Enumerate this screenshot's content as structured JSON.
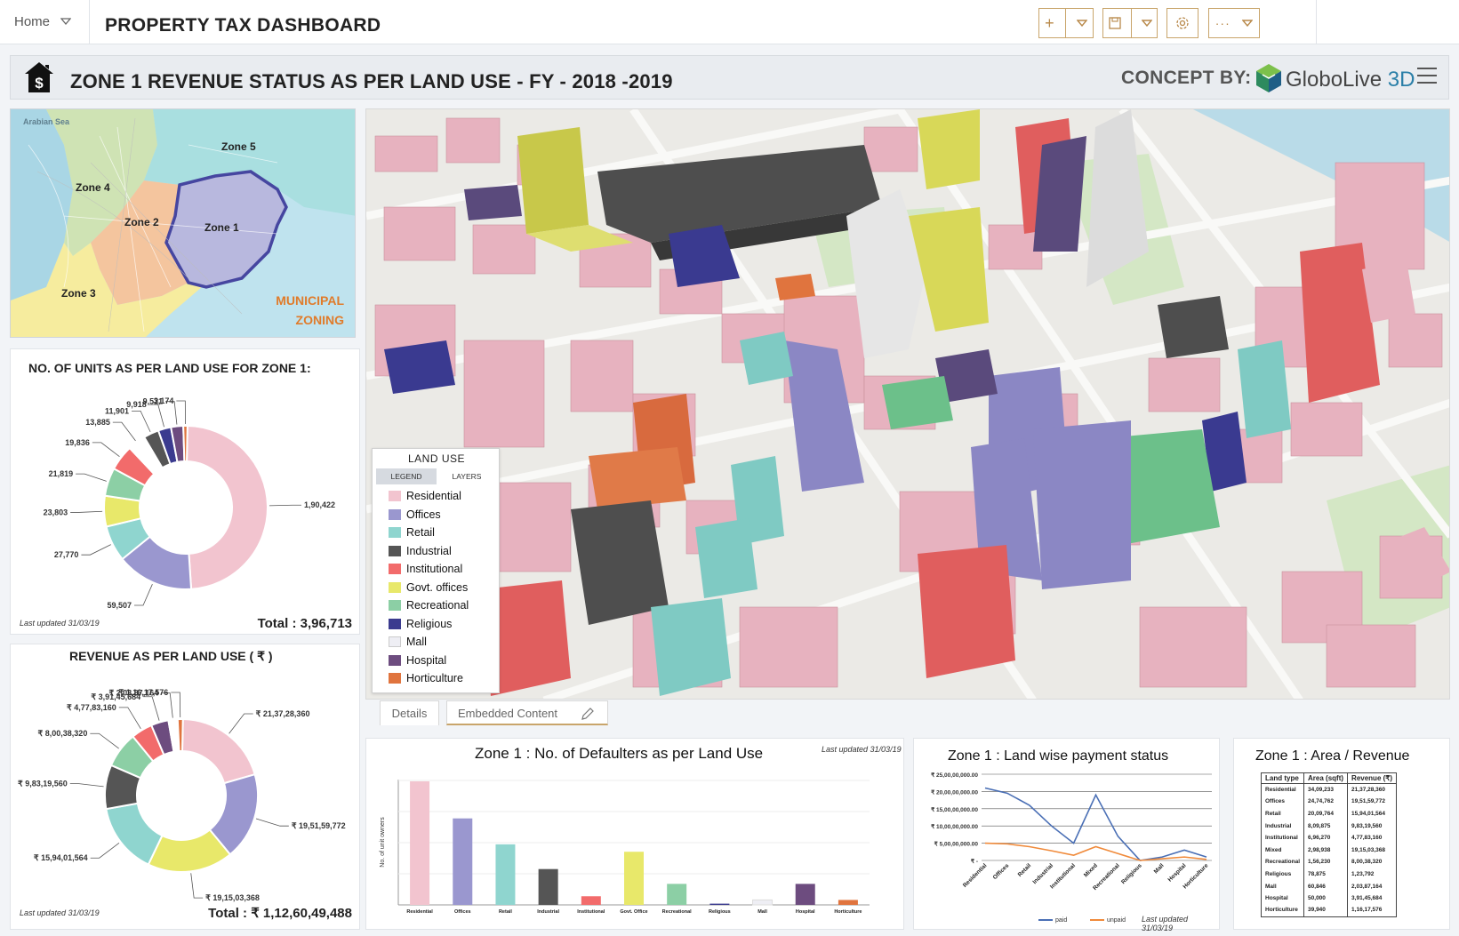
{
  "topbar": {
    "home_label": "Home",
    "dashboard_title": "PROPERTY TAX DASHBOARD",
    "buttons": [
      {
        "icon": "plus-icon",
        "has_dropdown": true
      },
      {
        "icon": "save-icon",
        "has_dropdown": true
      },
      {
        "icon": "gear-icon",
        "has_dropdown": false
      },
      {
        "icon": "more-icon",
        "has_dropdown": true
      }
    ]
  },
  "header": {
    "title": "ZONE 1 REVENUE STATUS AS PER LAND USE - FY - 2018 -2019",
    "concept_by": "CONCEPT BY:",
    "logo_text": "GloboLive",
    "logo_suffix": "3D"
  },
  "zone_map": {
    "sea_label": "Arabian Sea",
    "zones": [
      "Zone 5",
      "Zone 4",
      "Zone 2",
      "Zone 1",
      "Zone 3"
    ],
    "caption_line1": "MUNICIPAL",
    "caption_line2": "ZONING"
  },
  "units_panel": {
    "title": "NO. OF UNITS AS PER LAND USE FOR ZONE 1:",
    "last_updated": "Last updated 31/03/19",
    "total": "Total : 3,96,713"
  },
  "revenue_panel": {
    "title": "REVENUE AS PER LAND USE ( ₹ )",
    "last_updated": "Last updated 31/03/19",
    "total": "Total : ₹ 1,12,60,49,488"
  },
  "legend": {
    "title": "LAND USE",
    "tab_legend": "LEGEND",
    "tab_layers": "LAYERS",
    "items": [
      {
        "label": "Residential",
        "color": "#f2c4cf"
      },
      {
        "label": "Offices",
        "color": "#9a97cf"
      },
      {
        "label": "Retail",
        "color": "#8fd5cf"
      },
      {
        "label": "Industrial",
        "color": "#555555"
      },
      {
        "label": "Institutional",
        "color": "#f26b6b"
      },
      {
        "label": "Govt. offices",
        "color": "#e8e86a"
      },
      {
        "label": "Recreational",
        "color": "#8ccfa5"
      },
      {
        "label": "Religious",
        "color": "#3b3b8f"
      },
      {
        "label": "Mall",
        "color": "#eeeef4"
      },
      {
        "label": "Hospital",
        "color": "#6d4c7f"
      },
      {
        "label": "Horticulture",
        "color": "#e0743e"
      }
    ]
  },
  "tabs": {
    "details": "Details",
    "embedded": "Embedded Content"
  },
  "defaulters_panel": {
    "title": "Zone 1 : No. of Defaulters as per Land Use",
    "last_updated": "Last updated 31/03/19"
  },
  "payment_panel": {
    "title": "Zone 1 : Land wise payment status",
    "last_updated": "Last updated 31/03/19"
  },
  "area_panel": {
    "title": "Zone 1 : Area / Revenue",
    "columns": [
      "Land type",
      "Area (sqft)",
      "Revenue (₹)"
    ],
    "rows": [
      [
        "Residential",
        "34,09,233",
        "21,37,28,360"
      ],
      [
        "Offices",
        "24,74,762",
        "19,51,59,772"
      ],
      [
        "Retail",
        "20,09,764",
        "15,94,01,564"
      ],
      [
        "Industrial",
        "8,09,875",
        "9,83,19,560"
      ],
      [
        "Institutional",
        "6,96,270",
        "4,77,83,160"
      ],
      [
        "Mixed",
        "2,98,938",
        "19,15,03,368"
      ],
      [
        "Recreational",
        "1,56,230",
        "8,00,38,320"
      ],
      [
        "Religious",
        "78,875",
        "1,23,792"
      ],
      [
        "Mall",
        "60,846",
        "2,03,87,164"
      ],
      [
        "Hospital",
        "50,000",
        "3,91,45,684"
      ],
      [
        "Horticulture",
        "39,940",
        "1,16,17,576"
      ]
    ]
  },
  "chart_data": [
    {
      "type": "pie",
      "title": "NO. OF UNITS AS PER LAND USE FOR ZONE 1:",
      "categories": [
        "Residential",
        "Offices",
        "Retail",
        "Industrial",
        "Institutional",
        "Govt. offices",
        "Recreational",
        "Religious",
        "Mall",
        "Hospital",
        "Horticulture"
      ],
      "values": [
        190422,
        59507,
        27770,
        23803,
        21819,
        19836,
        13885,
        11901,
        9918,
        9521,
        3174
      ],
      "labels": [
        "1,90,422",
        "59,507",
        "27,770",
        "23,803",
        "21,819",
        "19,836",
        "13,885",
        "11,901",
        "9,918",
        "9,521",
        "3,174"
      ],
      "colors": [
        "#f2c4cf",
        "#9a97cf",
        "#8fd5cf",
        "#e8e86a",
        "#8ccfa5",
        "#f26b6b",
        "#ffffff",
        "#555555",
        "#3b3b8f",
        "#6d4c7f",
        "#e0743e"
      ],
      "donut": true
    },
    {
      "type": "pie",
      "title": "REVENUE AS PER LAND USE ( ₹ )",
      "categories": [
        "Residential",
        "Offices",
        "Govt. offices",
        "Retail",
        "Industrial",
        "Recreational",
        "Institutional",
        "Hospital",
        "Mall",
        "Religious",
        "Horticulture"
      ],
      "values": [
        213728360,
        195159772,
        191503368,
        159401564,
        98319560,
        80038320,
        47783160,
        39145684,
        20387164,
        123792,
        11617576
      ],
      "labels": [
        "₹ 21,37,28,360",
        "₹ 19,51,59,772",
        "₹ 19,15,03,368",
        "₹ 15,94,01,564",
        "₹ 9,83,19,560",
        "₹ 8,00,38,320",
        "₹ 4,77,83,160",
        "₹ 3,91,45,684",
        "₹ 2,03,87,164",
        "",
        "₹ 1,16,17,576"
      ],
      "colors": [
        "#f2c4cf",
        "#9a97cf",
        "#e8e86a",
        "#8fd5cf",
        "#555555",
        "#8ccfa5",
        "#f26b6b",
        "#6d4c7f",
        "#ffffff",
        "#3b3b8f",
        "#e0743e"
      ],
      "donut": true
    },
    {
      "type": "bar",
      "title": "Zone 1 : No. of Defaulters as per Land Use",
      "ylabel": "No. of unit owners",
      "categories": [
        "Residential",
        "Offices",
        "Retail",
        "Industrial",
        "Institutional",
        "Govt. Office",
        "Recreational",
        "Religious",
        "Mall",
        "Hospital",
        "Horticulture"
      ],
      "values": [
        100,
        70,
        49,
        29,
        7,
        43,
        17,
        1,
        4,
        17,
        4
      ],
      "colors": [
        "#f2c4cf",
        "#9a97cf",
        "#8fd5cf",
        "#555555",
        "#f26b6b",
        "#e8e86a",
        "#8ccfa5",
        "#3b3b8f",
        "#eeeef4",
        "#6d4c7f",
        "#e0743e"
      ]
    },
    {
      "type": "line",
      "title": "Zone 1 : Land wise payment status",
      "categories": [
        "Residential",
        "Offices",
        "Retail",
        "Industrial",
        "Institutional",
        "Mixed",
        "Recreational",
        "Religious",
        "Mall",
        "Hospital",
        "Horticulture"
      ],
      "yticks": [
        "₹ 25,00,00,000.00",
        "₹ 20,00,00,000.00",
        "₹ 15,00,00,000.00",
        "₹ 10,00,00,000.00",
        "₹ 5,00,00,000.00",
        "₹ -"
      ],
      "ylim": [
        0,
        250000000
      ],
      "series": [
        {
          "name": "paid",
          "color": "#4a6fb5",
          "values": [
            210000000,
            195000000,
            160000000,
            100000000,
            50000000,
            190000000,
            70000000,
            0,
            10000000,
            30000000,
            10000000
          ]
        },
        {
          "name": "unpaid",
          "color": "#f08a3a",
          "values": [
            50000000,
            48000000,
            40000000,
            28000000,
            15000000,
            40000000,
            20000000,
            0,
            5000000,
            10000000,
            3000000
          ]
        }
      ]
    }
  ]
}
